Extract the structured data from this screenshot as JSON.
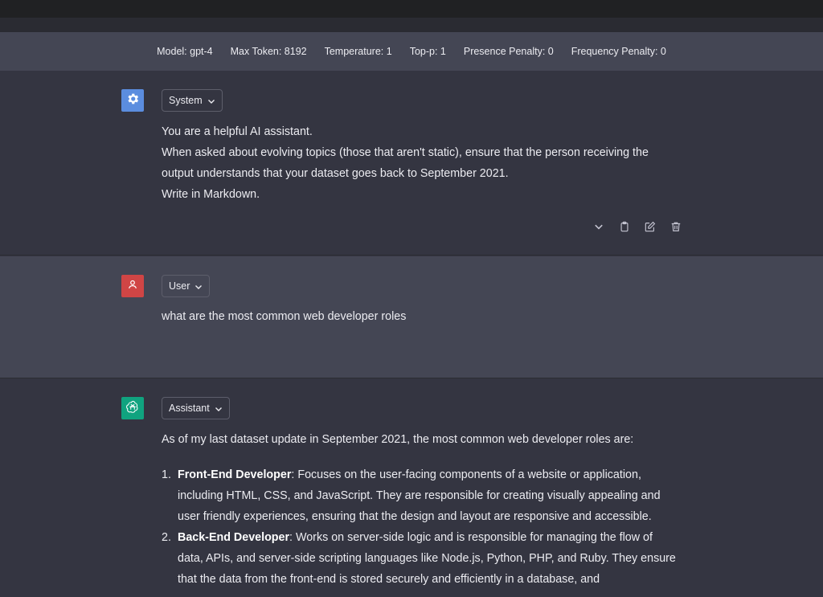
{
  "config": {
    "model": "Model: gpt-4",
    "max_token": "Max Token: 8192",
    "temperature": "Temperature: 1",
    "top_p": "Top-p: 1",
    "presence_penalty": "Presence Penalty: 0",
    "frequency_penalty": "Frequency Penalty: 0"
  },
  "colors": {
    "system_avatar": "#5b8ddf",
    "user_avatar": "#d04545",
    "assistant_avatar": "#10a37f"
  },
  "messages": {
    "system": {
      "role": "System",
      "avatar_icon": "gear-icon",
      "lines": [
        "You are a helpful AI assistant.",
        "When asked about evolving topics (those that aren't static), ensure that the person receiving the output understands that your dataset goes back to September 2021.",
        "Write in Markdown."
      ],
      "actions": [
        "chevron-down-icon",
        "clipboard-icon",
        "edit-icon",
        "trash-icon"
      ]
    },
    "user": {
      "role": "User",
      "avatar_icon": "person-icon",
      "text": "what are the most common web developer roles"
    },
    "assistant": {
      "role": "Assistant",
      "avatar_icon": "openai-logo-icon",
      "intro": "As of my last dataset update in September 2021, the most common web developer roles are:",
      "items": [
        {
          "title": "Front-End Developer",
          "text": ": Focuses on the user-facing components of a website or application, including HTML, CSS, and JavaScript. They are responsible for creating visually appealing and user friendly experiences, ensuring that the design and layout are responsive and accessible."
        },
        {
          "title": "Back-End Developer",
          "text": ": Works on server-side logic and is responsible for managing the flow of data, APIs, and server-side scripting languages like Node.js, Python, PHP, and Ruby. They ensure that the data from the front-end is stored securely and efficiently in a database, and"
        }
      ]
    }
  }
}
